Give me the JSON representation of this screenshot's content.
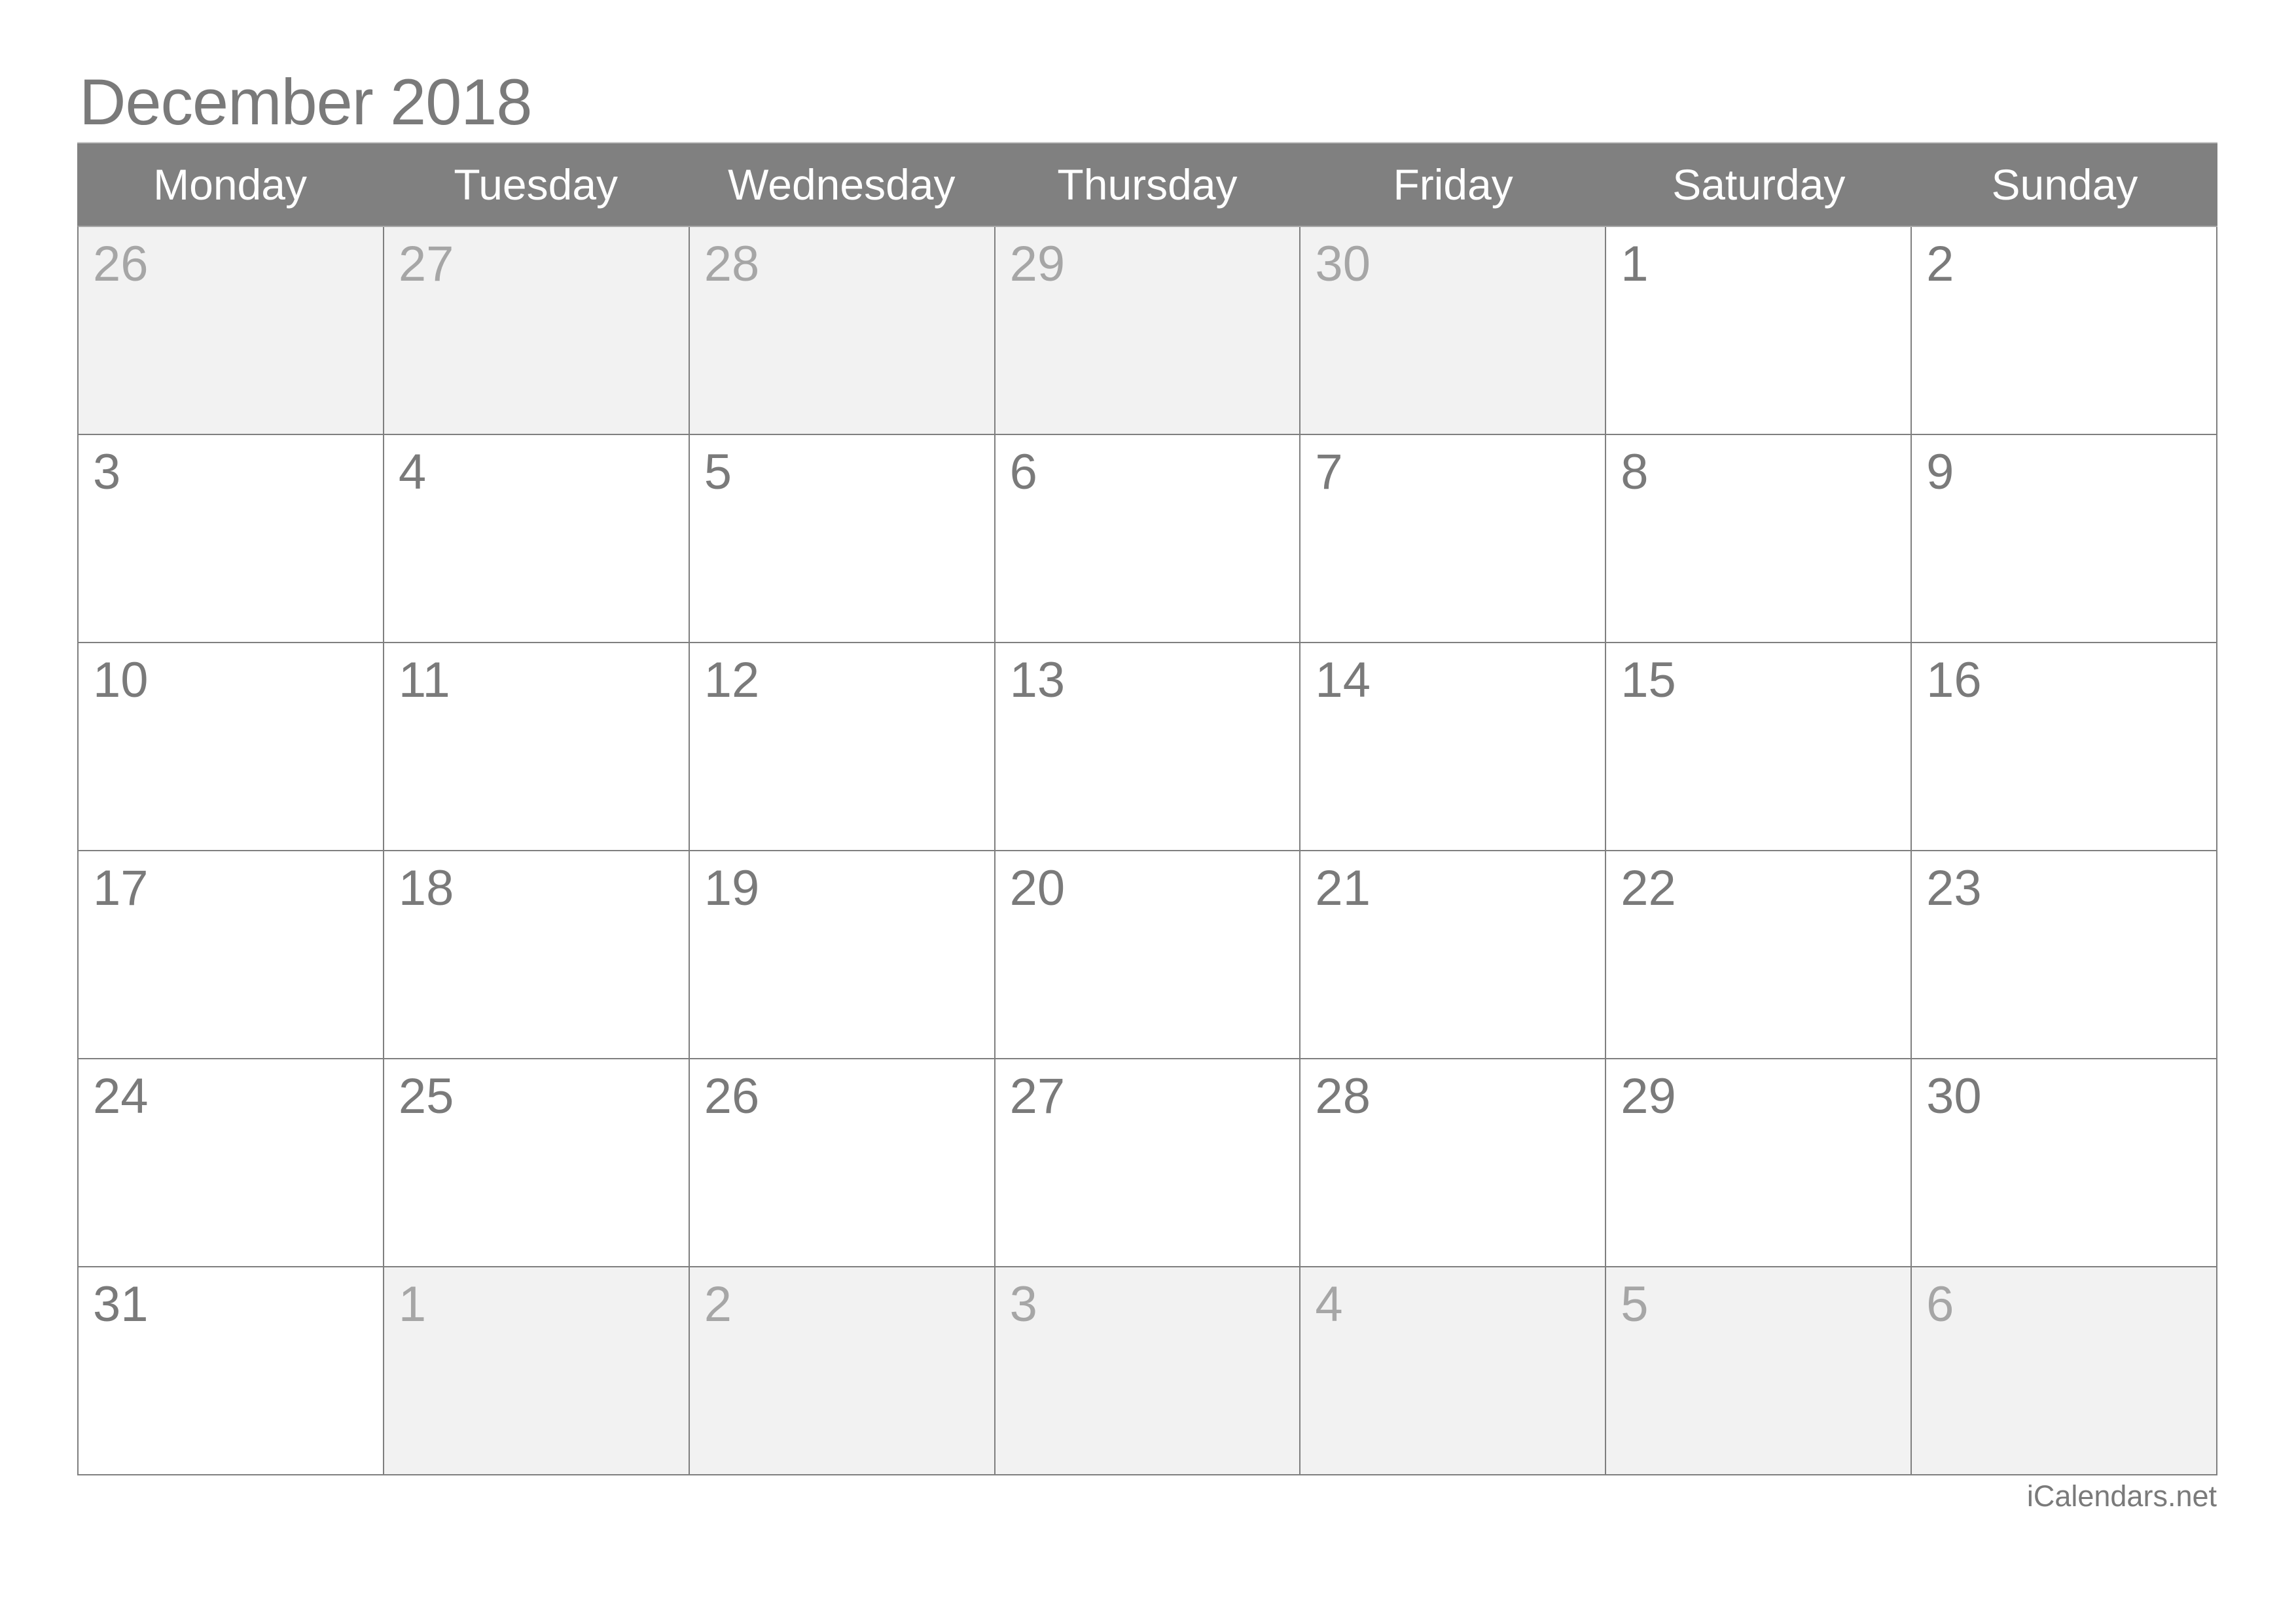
{
  "title": "December 2018",
  "weekdays": [
    "Monday",
    "Tuesday",
    "Wednesday",
    "Thursday",
    "Friday",
    "Saturday",
    "Sunday"
  ],
  "weeks": [
    [
      {
        "day": "26",
        "in_month": false
      },
      {
        "day": "27",
        "in_month": false
      },
      {
        "day": "28",
        "in_month": false
      },
      {
        "day": "29",
        "in_month": false
      },
      {
        "day": "30",
        "in_month": false
      },
      {
        "day": "1",
        "in_month": true
      },
      {
        "day": "2",
        "in_month": true
      }
    ],
    [
      {
        "day": "3",
        "in_month": true
      },
      {
        "day": "4",
        "in_month": true
      },
      {
        "day": "5",
        "in_month": true
      },
      {
        "day": "6",
        "in_month": true
      },
      {
        "day": "7",
        "in_month": true
      },
      {
        "day": "8",
        "in_month": true
      },
      {
        "day": "9",
        "in_month": true
      }
    ],
    [
      {
        "day": "10",
        "in_month": true
      },
      {
        "day": "11",
        "in_month": true
      },
      {
        "day": "12",
        "in_month": true
      },
      {
        "day": "13",
        "in_month": true
      },
      {
        "day": "14",
        "in_month": true
      },
      {
        "day": "15",
        "in_month": true
      },
      {
        "day": "16",
        "in_month": true
      }
    ],
    [
      {
        "day": "17",
        "in_month": true
      },
      {
        "day": "18",
        "in_month": true
      },
      {
        "day": "19",
        "in_month": true
      },
      {
        "day": "20",
        "in_month": true
      },
      {
        "day": "21",
        "in_month": true
      },
      {
        "day": "22",
        "in_month": true
      },
      {
        "day": "23",
        "in_month": true
      }
    ],
    [
      {
        "day": "24",
        "in_month": true
      },
      {
        "day": "25",
        "in_month": true
      },
      {
        "day": "26",
        "in_month": true
      },
      {
        "day": "27",
        "in_month": true
      },
      {
        "day": "28",
        "in_month": true
      },
      {
        "day": "29",
        "in_month": true
      },
      {
        "day": "30",
        "in_month": true
      }
    ],
    [
      {
        "day": "31",
        "in_month": true
      },
      {
        "day": "1",
        "in_month": false
      },
      {
        "day": "2",
        "in_month": false
      },
      {
        "day": "3",
        "in_month": false
      },
      {
        "day": "4",
        "in_month": false
      },
      {
        "day": "5",
        "in_month": false
      },
      {
        "day": "6",
        "in_month": false
      }
    ]
  ],
  "footer": "iCalendars.net",
  "colors": {
    "header_bg": "#808080",
    "header_text": "#ffffff",
    "title_text": "#7a7a7a",
    "day_text": "#7a7a7a",
    "other_month_text": "#a6a6a6",
    "other_month_bg": "#f2f2f2",
    "grid_line": "#7f7f7f"
  }
}
